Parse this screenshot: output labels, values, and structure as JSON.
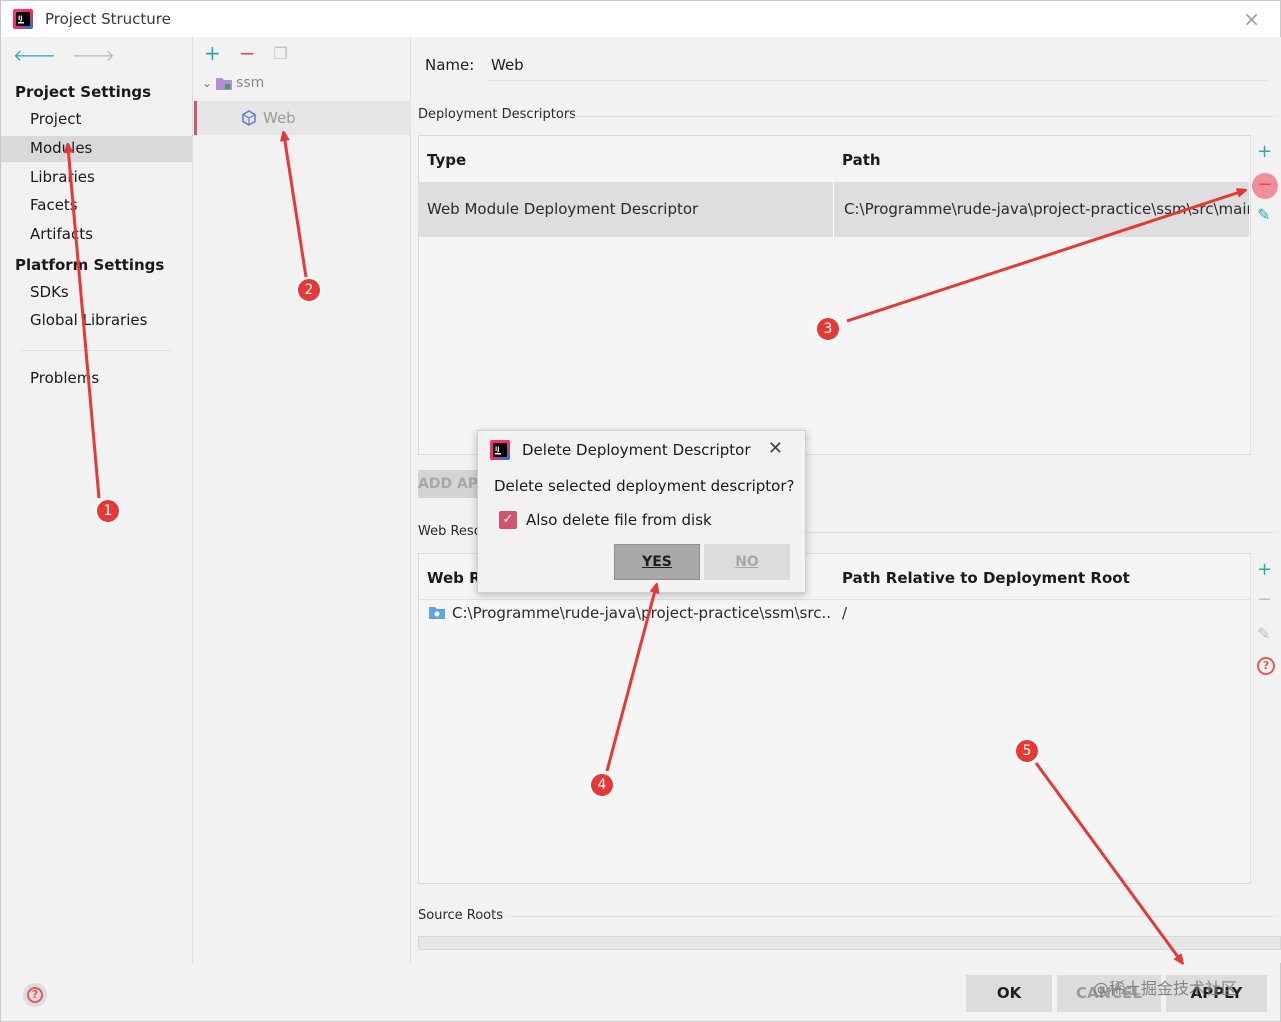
{
  "window": {
    "title": "Project Structure",
    "close_glyph": "×"
  },
  "sidebar": {
    "project_settings_label": "Project Settings",
    "items_project": [
      {
        "label": "Project"
      },
      {
        "label": "Modules",
        "selected": true
      },
      {
        "label": "Libraries"
      },
      {
        "label": "Facets"
      },
      {
        "label": "Artifacts"
      }
    ],
    "platform_settings_label": "Platform Settings",
    "items_platform": [
      {
        "label": "SDKs"
      },
      {
        "label": "Global Libraries"
      }
    ],
    "problems_label": "Problems"
  },
  "module_tree": {
    "root": "ssm",
    "selected_facet": "Web"
  },
  "details": {
    "name_label": "Name:",
    "name_value": "Web",
    "deployment_descriptors": {
      "title": "Deployment Descriptors",
      "columns": [
        "Type",
        "Path"
      ],
      "rows": [
        {
          "type": "Web Module Deployment Descriptor",
          "path": "C:\\Programme\\rude-java\\project-practice\\ssm\\src\\main"
        }
      ]
    },
    "add_app_button": "ADD AP",
    "web_resources": {
      "title": "Web Reso",
      "columns": [
        "Web R",
        "Path Relative to Deployment Root"
      ],
      "rows": [
        {
          "dir": "C:\\Programme\\rude-java\\project-practice\\ssm\\src...",
          "relative": "/"
        }
      ]
    },
    "source_roots_title": "Source Roots"
  },
  "dialog": {
    "title": "Delete Deployment Descriptor",
    "close_glyph": "✕",
    "message": "Delete selected deployment descriptor?",
    "checkbox_label": "Also delete file from disk",
    "checkbox_checked": true,
    "yes_label": "YES",
    "no_label": "NO"
  },
  "footer": {
    "ok": "OK",
    "cancel": "CANCEL",
    "apply": "APPLY",
    "watermark": "@稀土掘金技术社区"
  },
  "annotations": {
    "color": "#e53935",
    "badges": [
      "1",
      "2",
      "3",
      "4",
      "5"
    ]
  },
  "icons": {
    "back": "arrow-left-icon",
    "forward": "arrow-right-icon",
    "add": "plus-icon",
    "remove": "minus-icon",
    "copy": "copy-icon",
    "edit": "pencil-icon",
    "help": "help-icon"
  }
}
